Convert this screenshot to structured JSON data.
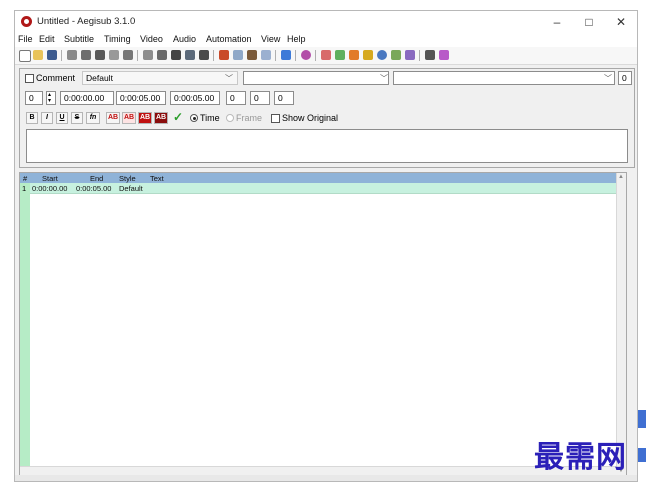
{
  "window": {
    "title": "Untitled - Aegisub 3.1.0",
    "controls": {
      "minimize": "–",
      "maximize": "□",
      "close": "✕"
    }
  },
  "menu": [
    "File",
    "Edit",
    "Subtitle",
    "Timing",
    "Video",
    "Audio",
    "Automation",
    "View",
    "Help"
  ],
  "toolbar": {
    "icons": [
      "new-file-icon",
      "open-file-icon",
      "save-icon",
      "jump-icon",
      "shift-times-icon",
      "styles-manager-icon",
      "properties-icon",
      "attachments-icon",
      "fonts-collector-icon",
      "resample-icon",
      "timing-postprocess-icon",
      "kanji-timer-icon",
      "translation-assistant-icon",
      "spell-check-icon",
      "find-icon",
      "replace-icon",
      "automation-icon",
      "video-details-icon",
      "snap-start-icon",
      "snap-end-icon",
      "zoom-icon",
      "options-icon",
      "hotkeys-icon",
      "select-lines-icon",
      "dummy-video-icon",
      "help-icon"
    ]
  },
  "editor": {
    "comment_label": "Comment",
    "style_value": "Default",
    "actor_value": "",
    "effect_value": "",
    "layer_value": "0",
    "margin_top_value": "0",
    "line_layer_value": "0",
    "start_time": "0:00:00.00",
    "end_time": "0:00:05.00",
    "duration": "0:00:05.00",
    "margin_l": "0",
    "margin_r": "0",
    "margin_v": "0",
    "format_buttons": [
      "B",
      "I",
      "U",
      "S",
      "fn",
      "AB",
      "AB",
      "AB",
      "AB"
    ],
    "commit_icon": "checkmark-icon",
    "radio_time_label": "Time",
    "radio_frame_label": "Frame",
    "show_original_label": "Show Original",
    "text_value": ""
  },
  "grid": {
    "columns": [
      "#",
      "Start",
      "End",
      "Style",
      "Text"
    ],
    "rows": [
      {
        "num": "1",
        "start": "0:00:00.00",
        "end": "0:00:05.00",
        "style": "Default",
        "text": ""
      }
    ]
  },
  "watermark": "最需网",
  "colors": {
    "grid_header": "#8fb3d8",
    "grid_row": "#c7f1df",
    "row_number_column": "#b6ecc6",
    "commit_green": "#2a9d2a",
    "watermark": "#2b20b8"
  }
}
